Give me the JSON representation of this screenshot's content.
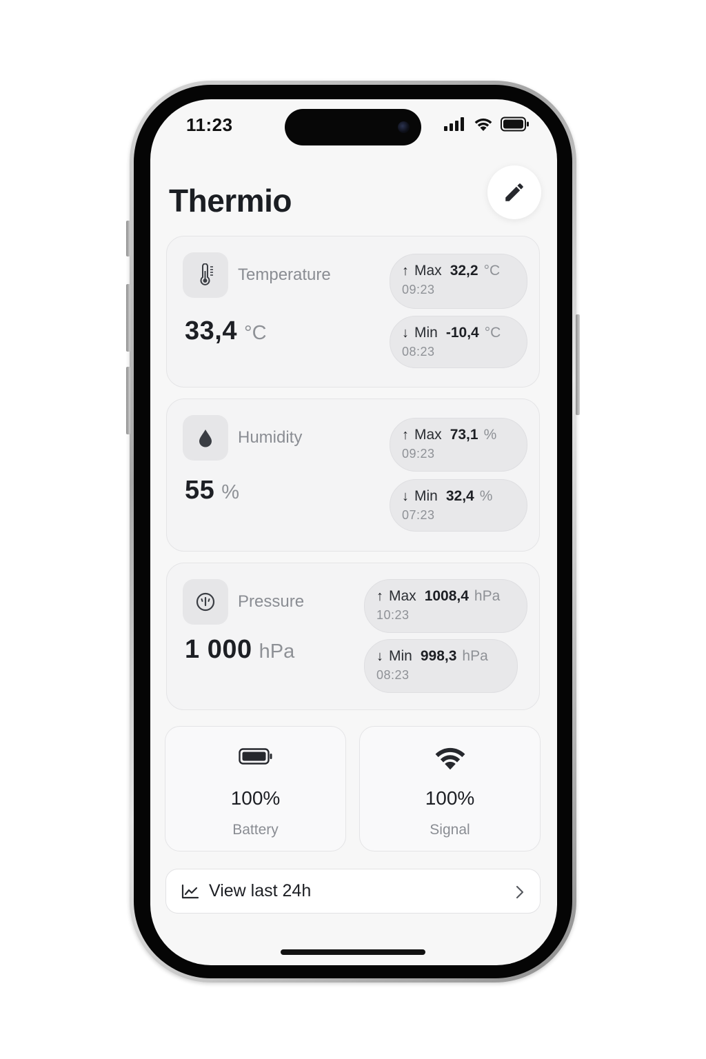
{
  "status_bar": {
    "time": "11:23",
    "icons": [
      "signal-icon",
      "wifi-icon",
      "battery-icon"
    ]
  },
  "header": {
    "title": "Thermio",
    "edit_icon": "pencil-icon"
  },
  "sensors": {
    "temperature": {
      "label": "Temperature",
      "icon": "thermometer-icon",
      "value": "33,4",
      "unit": "°C",
      "max": {
        "arrow": "↑",
        "label": "Max",
        "value": "32,2",
        "unit": "°C",
        "time": "09:23"
      },
      "min": {
        "arrow": "↓",
        "label": "Min",
        "value": "-10,4",
        "unit": "°C",
        "time": "08:23"
      }
    },
    "humidity": {
      "label": "Humidity",
      "icon": "droplet-icon",
      "value": "55",
      "unit": "%",
      "max": {
        "arrow": "↑",
        "label": "Max",
        "value": "73,1",
        "unit": "%",
        "time": "09:23"
      },
      "min": {
        "arrow": "↓",
        "label": "Min",
        "value": "32,4",
        "unit": "%",
        "time": "07:23"
      }
    },
    "pressure": {
      "label": "Pressure",
      "icon": "gauge-icon",
      "value": "1 000",
      "unit": "hPa",
      "max": {
        "arrow": "↑",
        "label": "Max",
        "value": "1008,4",
        "unit": "hPa",
        "time": "10:23"
      },
      "min": {
        "arrow": "↓",
        "label": "Min",
        "value": "998,3",
        "unit": "hPa",
        "time": "08:23"
      }
    }
  },
  "device": {
    "battery": {
      "value": "100%",
      "label": "Battery",
      "icon": "battery-icon",
      "level": 1.0
    },
    "signal": {
      "value": "100%",
      "label": "Signal",
      "icon": "wifi-icon",
      "level": 1.0
    }
  },
  "history": {
    "label": "View last 24h",
    "icon": "line-chart-icon",
    "chevron": "chevron-right-icon"
  },
  "colors": {
    "background": "#f7f7f7",
    "card": "#f4f4f5",
    "pill": "#e8e8ea",
    "text_primary": "#1d1f24",
    "text_secondary": "#8a8d93"
  }
}
